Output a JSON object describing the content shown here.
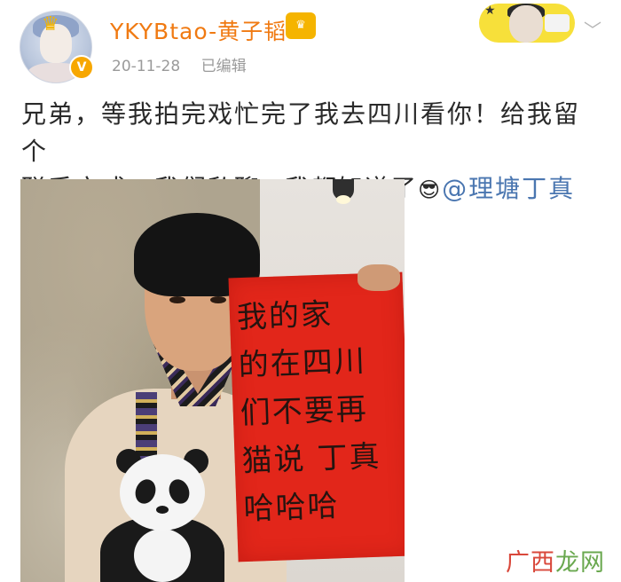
{
  "header": {
    "username": "YKYBtao-黄子韬",
    "timestamp": "20-11-28",
    "edited_label": "已编辑",
    "vip_badge": "V",
    "verified_badge": "V",
    "more_icon": "chevron-down-icon"
  },
  "post": {
    "text_line1": "兄弟，等我拍完戏忙完了我去四川看你！给我留个",
    "text_line2a": "联系方式，我们私聊",
    "emoji1": "😎",
    "text_line2b": "我都知道了",
    "emoji2": "😎",
    "mention": "@理塘丁真"
  },
  "photo": {
    "sign_lines": [
      "我的家",
      "的在四川",
      "们不要再",
      "猫说 丁真",
      "哈哈哈"
    ]
  },
  "watermark": {
    "part1": "广西",
    "part2": "龙网"
  },
  "colors": {
    "username": "#f07a12",
    "mention": "#4a76b0",
    "meta": "#9a9a9a",
    "sign_red": "#e2261a"
  }
}
